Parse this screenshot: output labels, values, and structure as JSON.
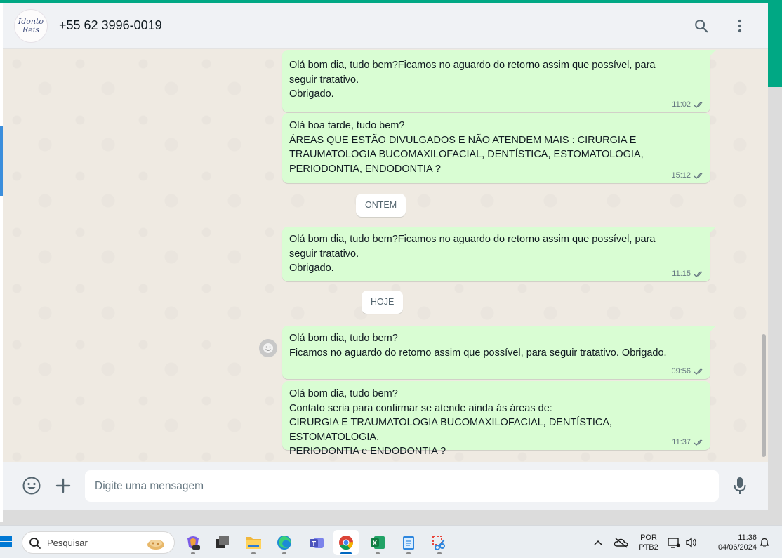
{
  "header": {
    "avatar_text": "Idonto\nReis",
    "contact_name": "+55 62 3996-0019",
    "search_icon": "search-icon",
    "menu_icon": "kebab-menu-icon"
  },
  "messages": [
    {
      "text": "Olá bom dia, tudo bem?Ficamos no aguardo do retorno assim que possível, para\nseguir tratativo.\nObrigado.",
      "time": "11:02"
    },
    {
      "text": "Olá boa tarde, tudo bem?\nÁREAS QUE ESTÃO DIVULGADOS E NÃO ATENDEM MAIS : CIRURGIA E\nTRAUMATOLOGIA BUCOMAXILOFACIAL, DENTÍSTICA, ESTOMATOLOGIA,\nPERIODONTIA, ENDODONTIA ?",
      "time": "15:12"
    },
    {
      "text": "Olá bom dia, tudo bem?Ficamos no aguardo do retorno assim que possível, para\nseguir tratativo.\nObrigado.",
      "time": "11:15"
    },
    {
      "text": "Olá bom dia, tudo bem?\nFicamos no aguardo do retorno assim que possível, para seguir tratativo. Obrigado.",
      "time": "09:56"
    },
    {
      "text": "Olá bom dia, tudo bem?\nContato seria para confirmar se atende ainda ás áreas de:\nCIRURGIA E TRAUMATOLOGIA BUCOMAXILOFACIAL, DENTÍSTICA, ESTOMATOLOGIA,\nPERIODONTIA  e ENDODONTIA ?",
      "time": "11:37"
    }
  ],
  "date_chips": {
    "yesterday": "ONTEM",
    "today": "HOJE"
  },
  "composer": {
    "placeholder": "Digite uma mensagem",
    "emoji_icon": "emoji-icon",
    "attach_icon": "plus-icon",
    "mic_icon": "microphone-icon"
  },
  "taskbar": {
    "search_placeholder": "Pesquisar",
    "language": "POR",
    "layout": "PTB2",
    "time": "11:36",
    "date": "04/06/2024",
    "apps": [
      "copilot-icon",
      "task-view-icon",
      "file-explorer-icon",
      "edge-icon",
      "teams-icon",
      "chrome-icon",
      "excel-icon",
      "notepad-icon",
      "snipping-tool-icon"
    ]
  },
  "colors": {
    "outgoing_bubble": "#d9fdd3",
    "chat_bg": "#efeae2",
    "header_bg": "#f0f2f5",
    "accent": "#00a884",
    "read_ticks": "#667781"
  }
}
